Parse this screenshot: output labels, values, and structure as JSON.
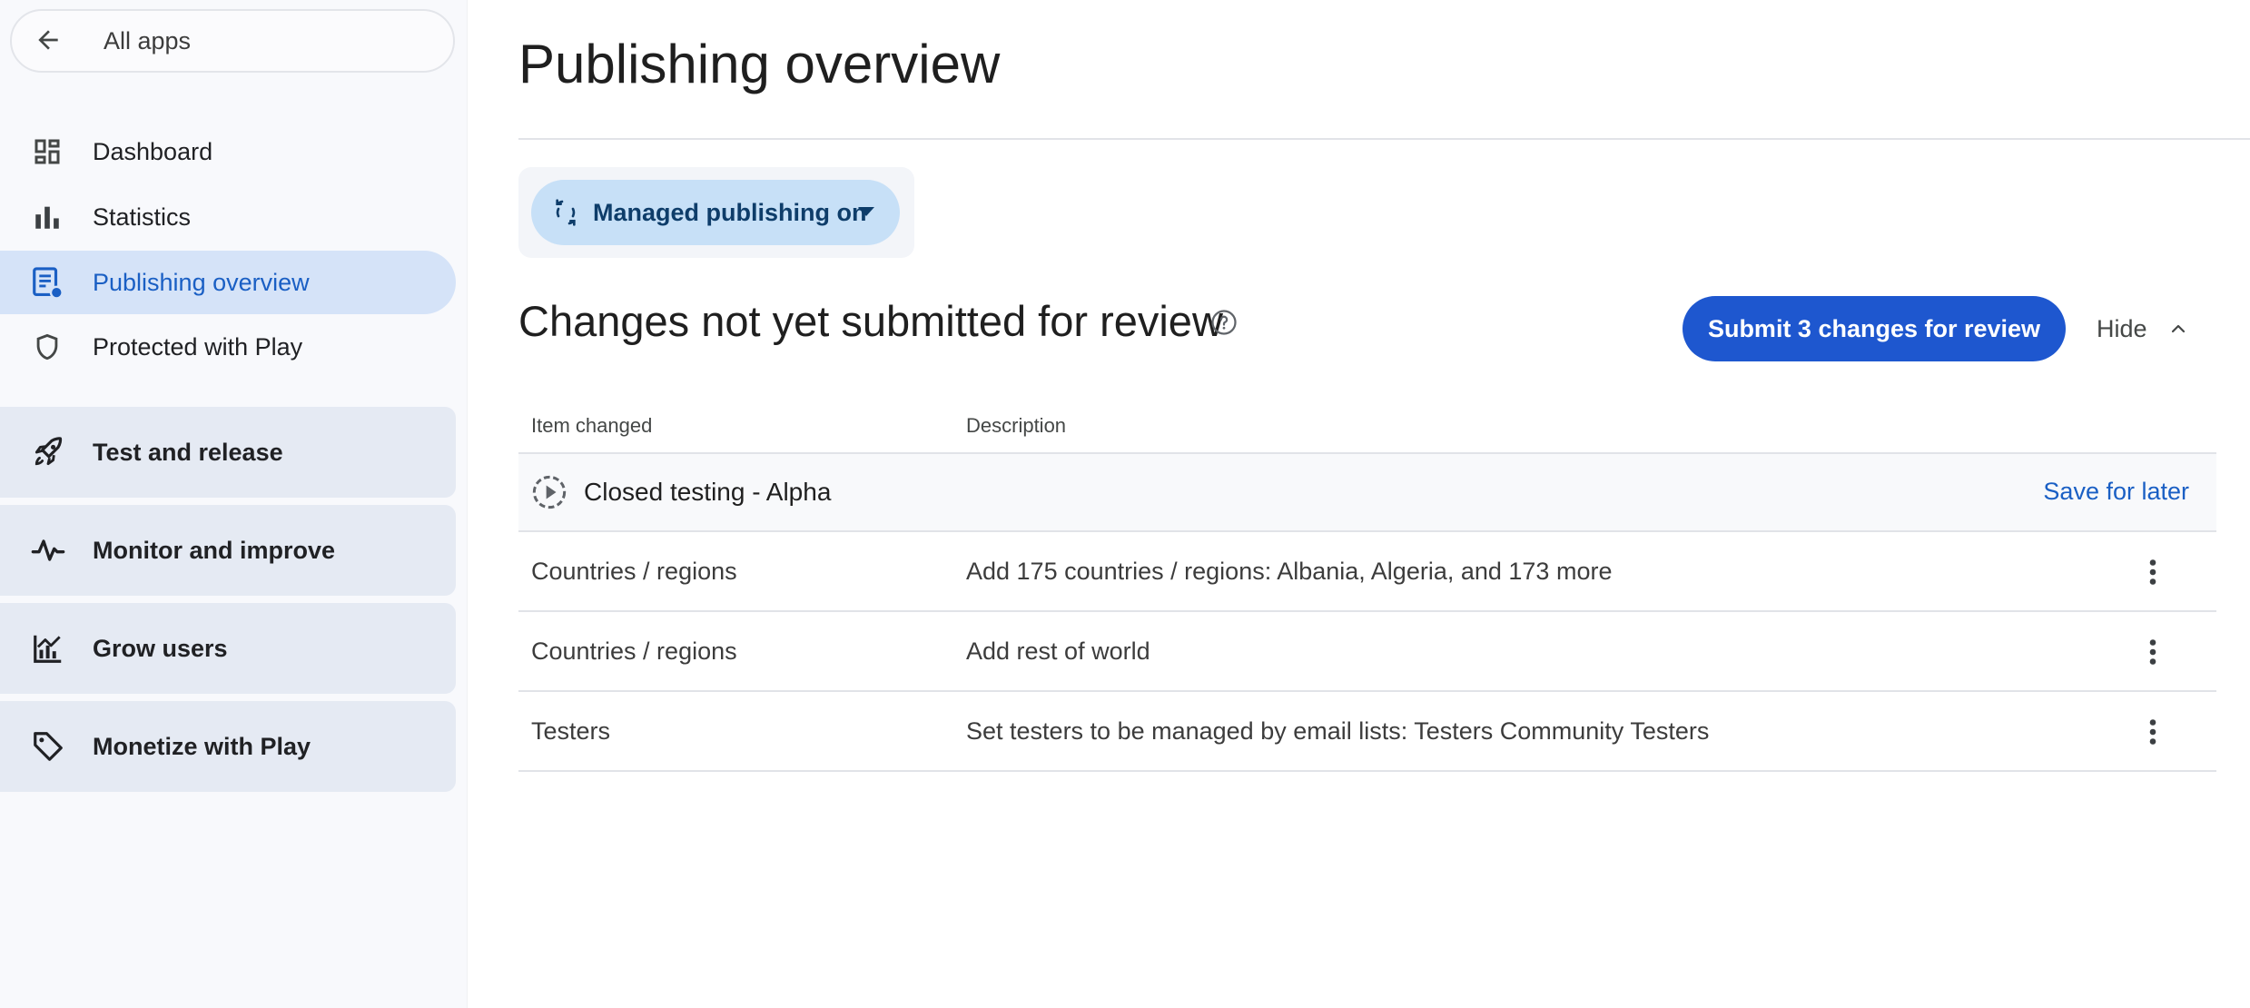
{
  "sidebar": {
    "all_apps_label": "All apps",
    "nav_items": [
      {
        "label": "Dashboard",
        "icon": "dashboard-icon"
      },
      {
        "label": "Statistics",
        "icon": "bar-chart-icon"
      },
      {
        "label": "Publishing overview",
        "icon": "publishing-icon",
        "active": true
      },
      {
        "label": "Protected with Play",
        "icon": "shield-icon"
      }
    ],
    "sections": [
      {
        "label": "Test and release",
        "icon": "rocket-icon"
      },
      {
        "label": "Monitor and improve",
        "icon": "pulse-icon"
      },
      {
        "label": "Grow users",
        "icon": "growth-chart-icon"
      },
      {
        "label": "Monetize with Play",
        "icon": "tag-icon"
      }
    ]
  },
  "main": {
    "page_title": "Publishing overview",
    "managed_publishing_label": "Managed publishing on",
    "changes_title": "Changes not yet submitted for review",
    "submit_label": "Submit 3 changes for review",
    "hide_label": "Hide",
    "table": {
      "headers": [
        "Item changed",
        "Description"
      ],
      "group": {
        "name": "Closed testing - Alpha",
        "action": "Save for later"
      },
      "rows": [
        {
          "item": "Countries / regions",
          "description": "Add 175 countries / regions: Albania, Algeria, and 173 more"
        },
        {
          "item": "Countries / regions",
          "description": "Add rest of world"
        },
        {
          "item": "Testers",
          "description": "Set testers to be managed by email lists: Testers Community Testers"
        }
      ]
    }
  },
  "colors": {
    "accent": "#1e57cf",
    "active_nav_bg": "#d5e3f8",
    "chip_bg": "#c7e0f7",
    "link": "#1a5fc4"
  }
}
